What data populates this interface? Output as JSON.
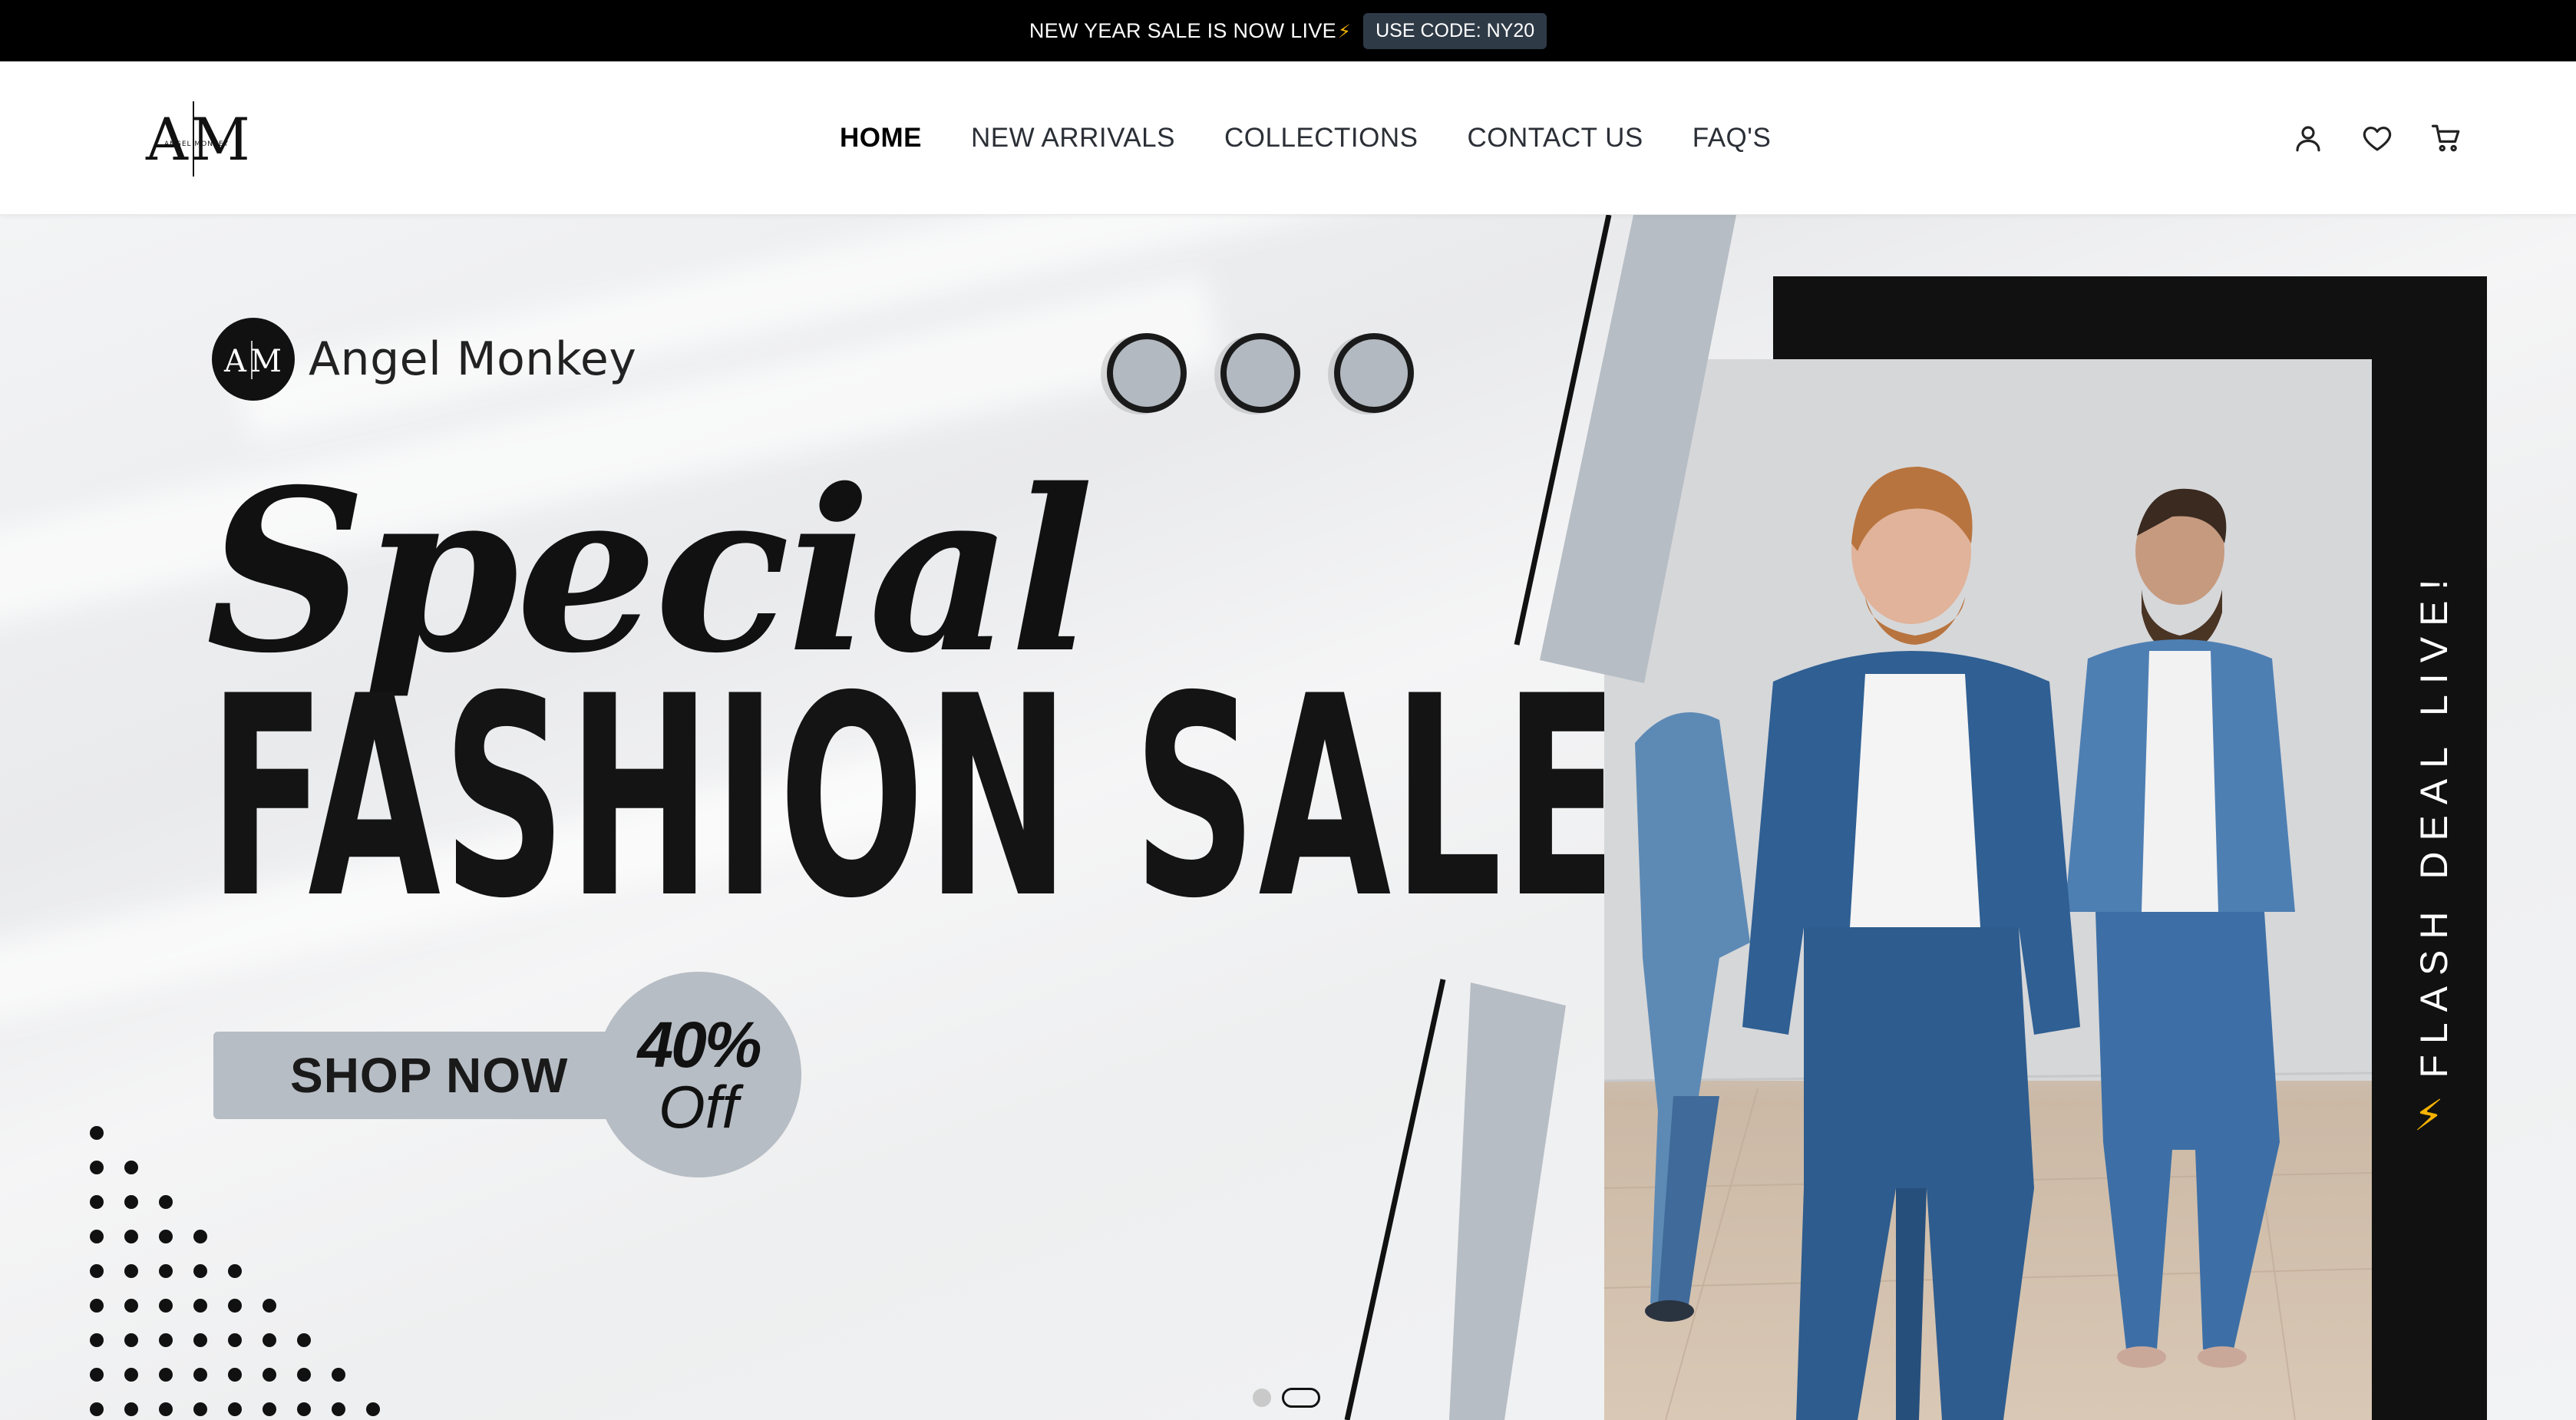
{
  "announcement": {
    "text": "NEW YEAR SALE IS NOW LIVE",
    "emoji": "⚡",
    "code_label": "USE CODE: NY20"
  },
  "header": {
    "logo_text": "AM",
    "logo_subtext": "ANGEL MONKEY",
    "nav": [
      {
        "label": "HOME",
        "active": true
      },
      {
        "label": "NEW ARRIVALS",
        "active": false
      },
      {
        "label": "COLLECTIONS",
        "active": false
      },
      {
        "label": "CONTACT US",
        "active": false
      },
      {
        "label": "FAQ'S",
        "active": false
      }
    ],
    "icons": [
      "user-icon",
      "heart-icon",
      "cart-icon"
    ]
  },
  "hero": {
    "brand_name": "Angel Monkey",
    "brand_logo_text": "AM",
    "script_title": "Special",
    "headline": "FASHION SALE",
    "shop_button": "SHOP NOW",
    "discount_pct": "40%",
    "discount_off": "Off",
    "side_banner": "FLASH DEAL LIVE!",
    "side_banner_emoji": "⚡",
    "slides_total": 2,
    "active_slide": 2,
    "colors": {
      "accent_gray": "#b7bdc5",
      "dark": "#111111",
      "bolt": "#f5b301"
    }
  }
}
